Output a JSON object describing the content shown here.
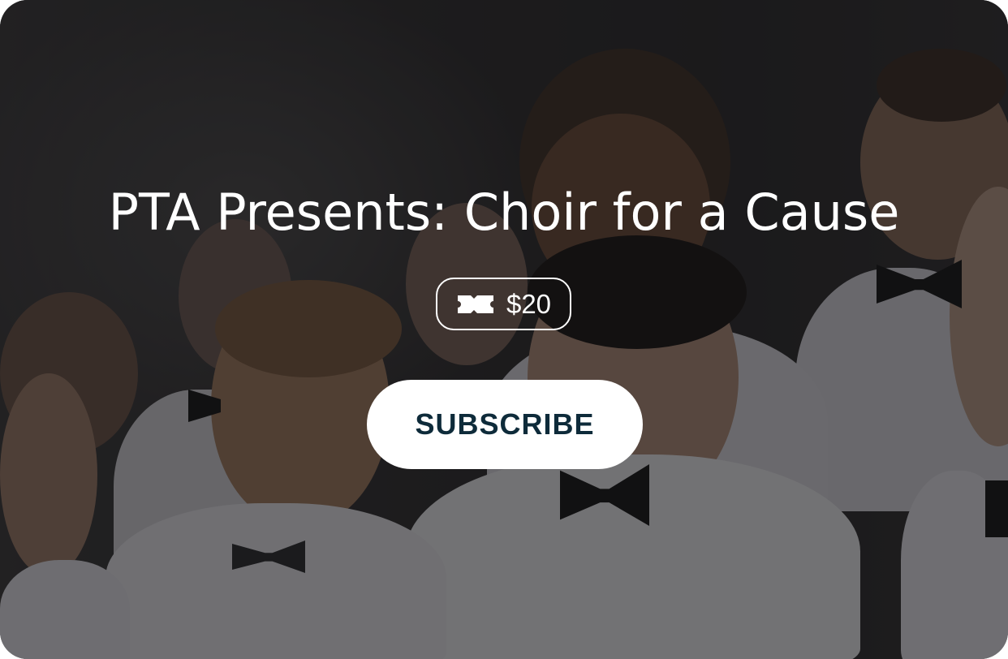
{
  "event": {
    "title": "PTA Presents: Choir for a Cause",
    "price": "$20",
    "price_icon": "ticket-icon"
  },
  "actions": {
    "subscribe_label": "SUBSCRIBE"
  },
  "colors": {
    "overlay": "#0e0e10",
    "title_text": "#ffffff",
    "button_background": "#ffffff",
    "button_text": "#0e2b3a"
  }
}
